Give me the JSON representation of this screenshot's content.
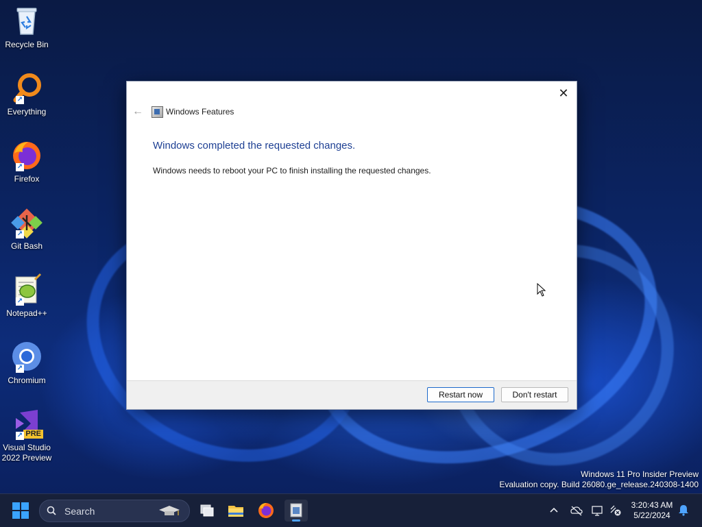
{
  "desktop": {
    "icons": [
      {
        "label": "Recycle Bin",
        "icon": "recycle-bin-icon"
      },
      {
        "label": "Everything",
        "icon": "everything-search-icon"
      },
      {
        "label": "Firefox",
        "icon": "firefox-icon"
      },
      {
        "label": "Git Bash",
        "icon": "git-bash-icon"
      },
      {
        "label": "Notepad++",
        "icon": "notepadpp-icon"
      },
      {
        "label": "Chromium",
        "icon": "chromium-icon"
      },
      {
        "label": "Visual Studio\n2022 Preview",
        "icon": "visual-studio-icon",
        "badge": "PRE"
      }
    ]
  },
  "dialog": {
    "title": "Windows Features",
    "close_glyph": "✕",
    "back_glyph": "←",
    "heading": "Windows completed the requested changes.",
    "message": "Windows needs to reboot your PC to finish installing the requested changes.",
    "buttons": {
      "restart": "Restart now",
      "dont_restart": "Don't restart"
    }
  },
  "watermark": {
    "line1": "Windows 11 Pro Insider Preview",
    "line2": "Evaluation copy. Build 26080.ge_release.240308-1400"
  },
  "taskbar": {
    "search_placeholder": "Search",
    "pinned": [
      "task-view-icon",
      "file-explorer-icon",
      "firefox-icon",
      "windows-features-icon"
    ],
    "active_app": "windows-features-icon",
    "tray": {
      "chevron": "^",
      "icons": [
        "onedrive-icon",
        "display-icon",
        "network-icon"
      ]
    },
    "clock": {
      "time": "3:20:43 AM",
      "date": "5/22/2024"
    }
  },
  "colors": {
    "accent": "#1a67c9",
    "heading": "#1d3f93",
    "taskbar": "#172039"
  }
}
